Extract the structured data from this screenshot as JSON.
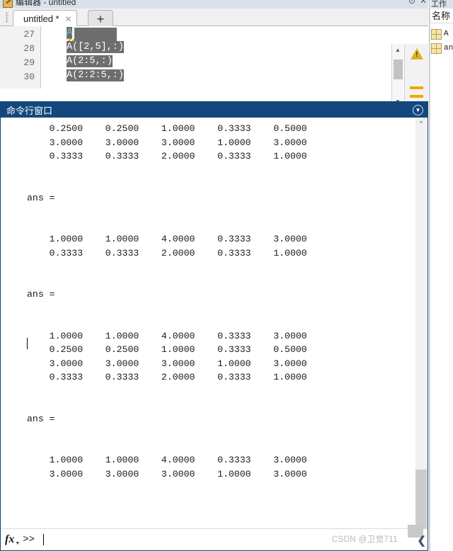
{
  "window": {
    "title": "编辑器 - untitled",
    "icon": "editor-icon",
    "minimize_label": "⊙",
    "close_label": "✕"
  },
  "editor": {
    "tab": {
      "label": "untitled *",
      "close_label": "✕"
    },
    "new_tab_label": "+",
    "line_numbers": [
      "27",
      "28",
      "29",
      "30"
    ],
    "lines": [
      {
        "number": "27",
        "text": "A",
        "selected": true
      },
      {
        "number": "28",
        "text": "A([2,5],:)",
        "selected": true
      },
      {
        "number": "29",
        "text": "A(2:5,:)",
        "selected": true
      },
      {
        "number": "30",
        "text": "A(2:2:5,:)",
        "selected": true
      }
    ],
    "markers": {
      "warning_icon": "warning-triangle-icon",
      "dash_count": 2
    },
    "scroll_up_label": "▲",
    "scroll_down_label": "▼",
    "hscroll_left_label": "◀",
    "hscroll_right_label": "▶"
  },
  "command_window": {
    "title": "命令行窗口",
    "menu_button_label": "▼",
    "scroll_up_label": "^",
    "output": "    0.2500    0.2500    1.0000    0.3333    0.5000\n    3.0000    3.0000    3.0000    1.0000    3.0000\n    0.3333    0.3333    2.0000    0.3333    1.0000\n\n\nans =\n\n\n    1.0000    1.0000    4.0000    0.3333    3.0000\n    0.3333    0.3333    2.0000    0.3333    1.0000\n\n\nans =\n\n\n    1.0000    1.0000    4.0000    0.3333    3.0000\n    0.2500    0.2500    1.0000    0.3333    0.5000\n    3.0000    3.0000    3.0000    1.0000    3.0000\n    0.3333    0.3333    2.0000    0.3333    1.0000\n\n\nans =\n\n\n    1.0000    1.0000    4.0000    0.3333    3.0000\n    3.0000    3.0000    3.0000    1.0000    3.0000",
    "prompt": {
      "fx_label": "fx",
      "prompt_symbol": ">>",
      "input_value": ""
    }
  },
  "workspace": {
    "panel_title": "工作区",
    "column_header": "名称",
    "variables": [
      {
        "name": "A",
        "icon": "matrix-icon"
      },
      {
        "name": "ans",
        "icon": "matrix-icon"
      }
    ],
    "collapse_label": "❮"
  },
  "watermark": {
    "text": "CSDN @卫觉711"
  }
}
